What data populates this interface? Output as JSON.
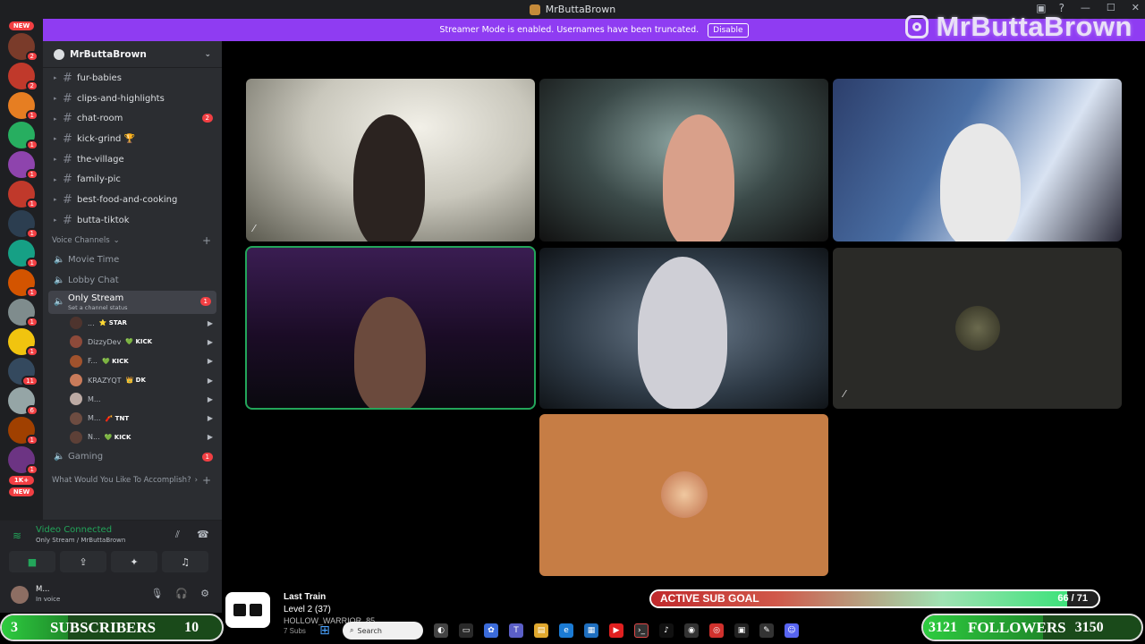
{
  "window": {
    "title": "MrButtaBrown"
  },
  "banner": {
    "text": "Streamer Mode is enabled. Usernames have been truncated.",
    "disable_label": "Disable"
  },
  "brand_overlay": "MrButtaBrown",
  "rail": {
    "new_top": "NEW",
    "new_bottom": "NEW",
    "badges": [
      "2",
      "2",
      "1",
      "1",
      "1",
      "1",
      "1",
      "1",
      "1",
      "1",
      "1",
      "11",
      "6",
      "1",
      "1"
    ],
    "count_tag": "1K+"
  },
  "server": {
    "name": "MrButtaBrown"
  },
  "text_channels": [
    {
      "name": "fur-babies",
      "mention": ""
    },
    {
      "name": "clips-and-highlights",
      "mention": ""
    },
    {
      "name": "chat-room",
      "mention": "2"
    },
    {
      "name": "kick-grind 🏆",
      "mention": ""
    },
    {
      "name": "the-village",
      "mention": ""
    },
    {
      "name": "family-pic",
      "mention": ""
    },
    {
      "name": "best-food-and-cooking",
      "mention": ""
    },
    {
      "name": "butta-tiktok",
      "mention": ""
    }
  ],
  "voice_section": {
    "label": "Voice Channels"
  },
  "voice_channels": {
    "movie_time": "Movie Time",
    "lobby_chat": "Lobby Chat",
    "only_stream": "Only Stream",
    "only_stream_mention": "1",
    "only_stream_status": "Set a channel status",
    "gaming": "Gaming",
    "gaming_mention": "1"
  },
  "voice_users": [
    {
      "name": "...",
      "tag": "⭐ STAR"
    },
    {
      "name": "DizzyDev",
      "tag": "💚 KICK"
    },
    {
      "name": "F...",
      "tag": "💚 KICK"
    },
    {
      "name": "KRAZYQT",
      "tag": "👑 DK"
    },
    {
      "name": "M...",
      "tag": ""
    },
    {
      "name": "M...",
      "tag": "🧨 TNT"
    },
    {
      "name": "N...",
      "tag": "💚 KICK"
    }
  ],
  "bottom_section": {
    "label": "What Would You Like To Accomplish?"
  },
  "voice_panel": {
    "status": "Video Connected",
    "location": "Only Stream / MrButtaBrown"
  },
  "user_panel": {
    "name": "M...",
    "status": "In voice"
  },
  "overlay": {
    "last_train": {
      "title": "Last Train",
      "level": "Level 2 (37)",
      "line3": "HOLLOW_WARRIOR_85",
      "line4": "7 Subs"
    },
    "sub_goal": {
      "label": "ACTIVE SUB GOAL",
      "current": 66,
      "target": 71,
      "count_text": "66 / 71"
    },
    "subscribers": {
      "start": "3",
      "label": "SUBSCRIBERS",
      "target": "10",
      "progress": 0.3
    },
    "followers": {
      "start": "3121",
      "label": "FOLLOWERS",
      "target": "3150",
      "progress": 0.55
    }
  },
  "taskbar": {
    "search_placeholder": "Search"
  },
  "colors": {
    "accent": "#8f3cf2",
    "speaking": "#23a55a",
    "mention": "#f23f43",
    "sidebar": "#2b2d31"
  }
}
